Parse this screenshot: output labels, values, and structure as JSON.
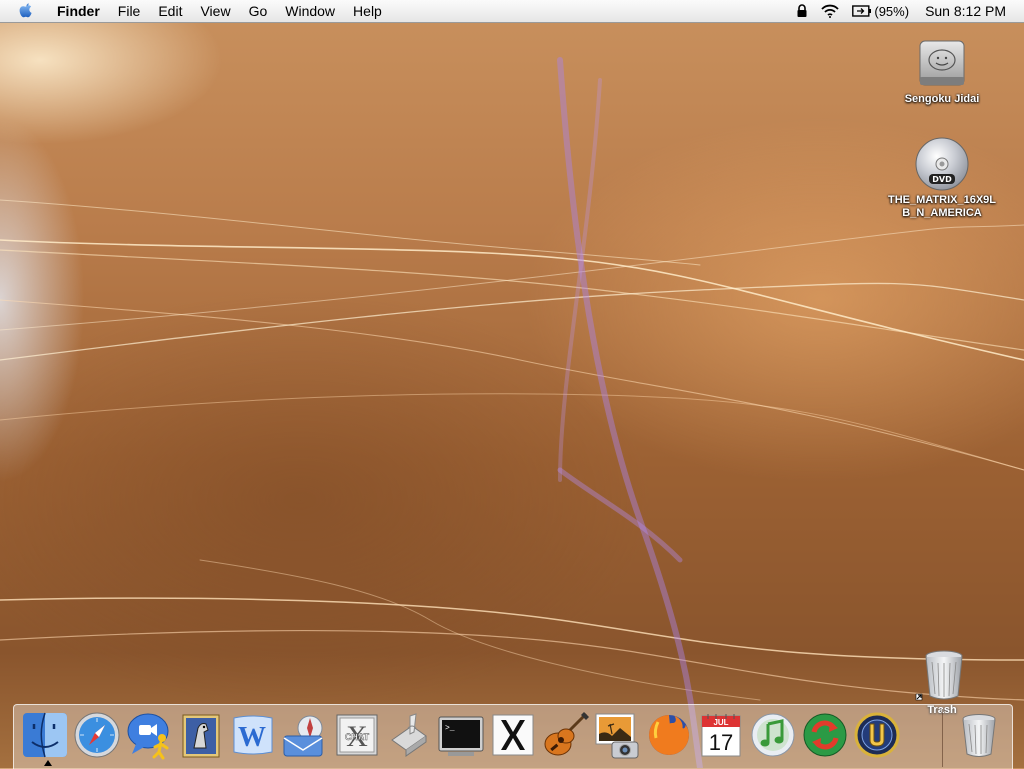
{
  "menubar": {
    "app_name": "Finder",
    "menus": [
      "File",
      "Edit",
      "View",
      "Go",
      "Window",
      "Help"
    ],
    "battery_percent": "(95%)",
    "clock": "Sun 8:12 PM"
  },
  "desktop": {
    "icons": [
      {
        "label": "Sengoku Jidai",
        "icon": "hard-drive-icon"
      },
      {
        "label": "THE_MATRIX_16X9LB_N_AMERICA",
        "icon": "dvd-disc-icon"
      },
      {
        "label": "Trash",
        "icon": "trash-alias-icon"
      }
    ]
  },
  "dock": {
    "items": [
      {
        "name": "Finder",
        "icon": "finder-icon"
      },
      {
        "name": "Safari",
        "icon": "safari-compass-icon"
      },
      {
        "name": "iChat",
        "icon": "ichat-icon"
      },
      {
        "name": "Mail",
        "icon": "mail-eagle-icon"
      },
      {
        "name": "Word",
        "icon": "word-icon"
      },
      {
        "name": "Mail",
        "icon": "mail-icon"
      },
      {
        "name": "Chat",
        "icon": "chat-icon"
      },
      {
        "name": "Script Editor",
        "icon": "script-editor-icon"
      },
      {
        "name": "Terminal",
        "icon": "terminal-icon"
      },
      {
        "name": "X11",
        "icon": "x11-icon"
      },
      {
        "name": "GarageBand",
        "icon": "guitar-icon"
      },
      {
        "name": "iPhoto",
        "icon": "iphoto-icon"
      },
      {
        "name": "Firefox",
        "icon": "firefox-icon"
      },
      {
        "name": "iCal",
        "icon": "ical-icon"
      },
      {
        "name": "iTunes",
        "icon": "itunes-icon"
      },
      {
        "name": "Sync",
        "icon": "sync-icon"
      },
      {
        "name": "Unreal Tournament",
        "icon": "unreal-icon"
      },
      {
        "name": "Trash",
        "icon": "trash-icon"
      }
    ],
    "ical_month": "JUL",
    "ical_day": "17",
    "chat_label": "CHAT",
    "x11_label": "X"
  }
}
